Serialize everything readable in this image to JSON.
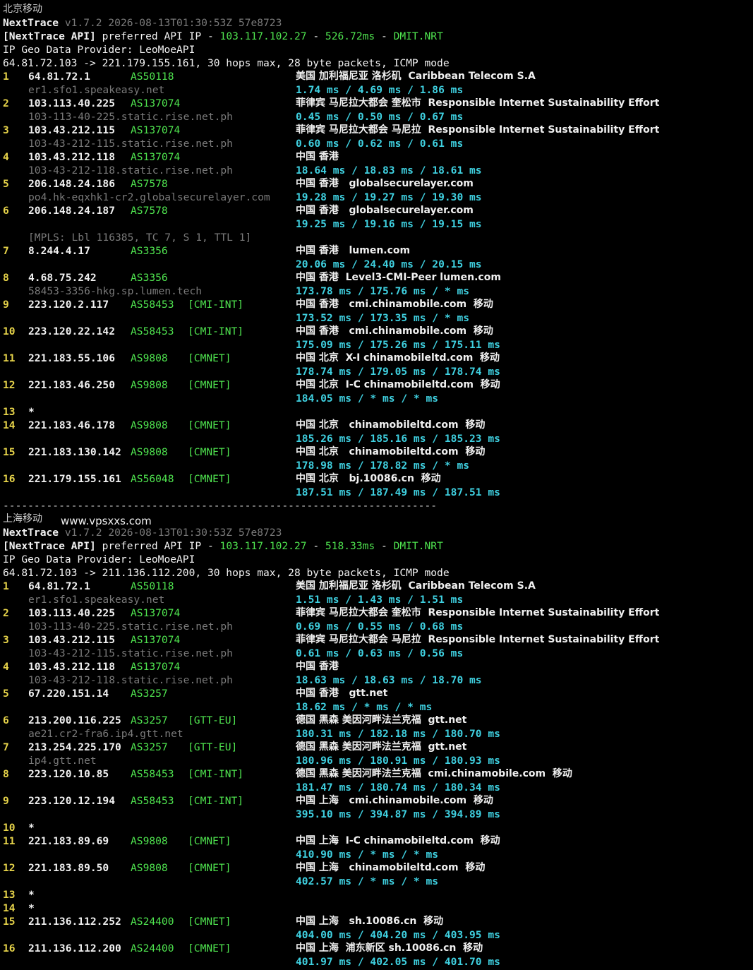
{
  "block1": {
    "title": "北京移动",
    "version_line": {
      "name": "NextTrace",
      "rest": " v1.7.2 2026-08-13T01:30:53Z 57e8723"
    },
    "api_line": {
      "prefix": "[NextTrace API]",
      "mid": " preferred API IP - ",
      "ip": "103.117.102.27",
      "sep": " - ",
      "ms": "526.72ms",
      "sep2": " - ",
      "node": "DMIT.NRT"
    },
    "geo_provider": "IP Geo Data Provider: LeoMoeAPI",
    "target_line": "64.81.72.103 -> 221.179.155.161, 30 hops max, 28 byte packets, ICMP mode",
    "hops": [
      {
        "n": "1",
        "ip": "64.81.72.1",
        "as": "AS50118",
        "tag": "",
        "geo": "美国 加利福尼亚 洛杉矶  Caribbean Telecom S.A",
        "host": "er1.sfo1.speakeasy.net",
        "rtt": "1.74 ms / 4.69 ms / 1.86 ms"
      },
      {
        "n": "2",
        "ip": "103.113.40.225",
        "as": "AS137074",
        "tag": "",
        "geo": "菲律宾 马尼拉大都会 奎松市  Responsible Internet Sustainability Effort",
        "host": "103-113-40-225.static.rise.net.ph",
        "rtt": "0.45 ms / 0.50 ms / 0.67 ms"
      },
      {
        "n": "3",
        "ip": "103.43.212.115",
        "as": "AS137074",
        "tag": "",
        "geo": "菲律宾 马尼拉大都会 马尼拉  Responsible Internet Sustainability Effort",
        "host": "103-43-212-115.static.rise.net.ph",
        "rtt": "0.60 ms / 0.62 ms / 0.61 ms"
      },
      {
        "n": "4",
        "ip": "103.43.212.118",
        "as": "AS137074",
        "tag": "",
        "geo": "中国 香港",
        "host": "103-43-212-118.static.rise.net.ph",
        "rtt": "18.64 ms / 18.83 ms / 18.61 ms"
      },
      {
        "n": "5",
        "ip": "206.148.24.186",
        "as": "AS7578",
        "tag": "",
        "geo": "中国 香港   globalsecurelayer.com",
        "host": "po4.hk-eqxhk1-cr2.globalsecurelayer.com",
        "rtt": "19.28 ms / 19.27 ms / 19.30 ms"
      },
      {
        "n": "6",
        "ip": "206.148.24.187",
        "as": "AS7578",
        "tag": "",
        "geo": "中国 香港   globalsecurelayer.com",
        "host": "",
        "rtt": "19.25 ms / 19.16 ms / 19.15 ms"
      },
      {
        "n": "",
        "ip": "",
        "as": "",
        "tag": "",
        "geo": "",
        "host": "[MPLS: Lbl 116385, TC 7, S 1, TTL 1]",
        "rtt": ""
      },
      {
        "n": "7",
        "ip": "8.244.4.17",
        "as": "AS3356",
        "tag": "",
        "geo": "中国 香港   lumen.com",
        "host": "",
        "rtt": "20.06 ms / 24.40 ms / 20.15 ms"
      },
      {
        "n": "8",
        "ip": "4.68.75.242",
        "as": "AS3356",
        "tag": "",
        "geo": "中国 香港  Level3-CMI-Peer lumen.com",
        "host": "58453-3356-hkg.sp.lumen.tech",
        "rtt": "173.78 ms / 175.76 ms / * ms"
      },
      {
        "n": "9",
        "ip": "223.120.2.117",
        "as": "AS58453",
        "tag": "[CMI-INT]",
        "geo": "中国 香港   cmi.chinamobile.com  移动",
        "host": "",
        "rtt": "173.52 ms / 173.35 ms / * ms"
      },
      {
        "n": "10",
        "ip": "223.120.22.142",
        "as": "AS58453",
        "tag": "[CMI-INT]",
        "geo": "中国 香港   cmi.chinamobile.com  移动",
        "host": "",
        "rtt": "175.09 ms / 175.26 ms / 175.11 ms"
      },
      {
        "n": "11",
        "ip": "221.183.55.106",
        "as": "AS9808",
        "tag": "[CMNET]",
        "geo": "中国 北京  X-I chinamobileltd.com  移动",
        "host": "",
        "rtt": "178.74 ms / 179.05 ms / 178.74 ms"
      },
      {
        "n": "12",
        "ip": "221.183.46.250",
        "as": "AS9808",
        "tag": "[CMNET]",
        "geo": "中国 北京  I-C chinamobileltd.com  移动",
        "host": "",
        "rtt": "184.05 ms / * ms / * ms"
      },
      {
        "n": "13",
        "ip": "*",
        "as": "",
        "tag": "",
        "geo": "",
        "host": "",
        "rtt": ""
      },
      {
        "n": "14",
        "ip": "221.183.46.178",
        "as": "AS9808",
        "tag": "[CMNET]",
        "geo": "中国 北京   chinamobileltd.com  移动",
        "host": "",
        "rtt": "185.26 ms / 185.16 ms / 185.23 ms"
      },
      {
        "n": "15",
        "ip": "221.183.130.142",
        "as": "AS9808",
        "tag": "[CMNET]",
        "geo": "中国 北京   chinamobileltd.com  移动",
        "host": "",
        "rtt": "178.98 ms / 178.82 ms / * ms"
      },
      {
        "n": "16",
        "ip": "221.179.155.161",
        "as": "AS56048",
        "tag": "[CMNET]",
        "geo": "中国 北京   bj.10086.cn  移动",
        "host": "",
        "rtt": "187.51 ms / 187.49 ms / 187.51 ms"
      }
    ]
  },
  "separator": "----------------------------------------------------------------------",
  "block2": {
    "title": "上海移动",
    "watermark": "www.vpsxxs.com",
    "version_line": {
      "name": "NextTrace",
      "rest": " v1.7.2 2026-08-13T01:30:53Z 57e8723"
    },
    "api_line": {
      "prefix": "[NextTrace API]",
      "mid": " preferred API IP - ",
      "ip": "103.117.102.27",
      "sep": " - ",
      "ms": "518.33ms",
      "sep2": " - ",
      "node": "DMIT.NRT"
    },
    "geo_provider": "IP Geo Data Provider: LeoMoeAPI",
    "target_line": "64.81.72.103 -> 211.136.112.200, 30 hops max, 28 byte packets, ICMP mode",
    "hops": [
      {
        "n": "1",
        "ip": "64.81.72.1",
        "as": "AS50118",
        "tag": "",
        "geo": "美国 加利福尼亚 洛杉矶  Caribbean Telecom S.A",
        "host": "er1.sfo1.speakeasy.net",
        "rtt": "1.51 ms / 1.43 ms / 1.51 ms"
      },
      {
        "n": "2",
        "ip": "103.113.40.225",
        "as": "AS137074",
        "tag": "",
        "geo": "菲律宾 马尼拉大都会 奎松市  Responsible Internet Sustainability Effort",
        "host": "103-113-40-225.static.rise.net.ph",
        "rtt": "0.69 ms / 0.55 ms / 0.68 ms"
      },
      {
        "n": "3",
        "ip": "103.43.212.115",
        "as": "AS137074",
        "tag": "",
        "geo": "菲律宾 马尼拉大都会 马尼拉  Responsible Internet Sustainability Effort",
        "host": "103-43-212-115.static.rise.net.ph",
        "rtt": "0.61 ms / 0.63 ms / 0.56 ms"
      },
      {
        "n": "4",
        "ip": "103.43.212.118",
        "as": "AS137074",
        "tag": "",
        "geo": "中国 香港",
        "host": "103-43-212-118.static.rise.net.ph",
        "rtt": "18.63 ms / 18.63 ms / 18.70 ms"
      },
      {
        "n": "5",
        "ip": "67.220.151.14",
        "as": "AS3257",
        "tag": "",
        "geo": "中国 香港   gtt.net",
        "host": "",
        "rtt": "18.62 ms / * ms / * ms"
      },
      {
        "n": "6",
        "ip": "213.200.116.225",
        "as": "AS3257",
        "tag": "[GTT-EU]",
        "geo": "德国 黑森 美因河畔法兰克福  gtt.net",
        "host": "ae21.cr2-fra6.ip4.gtt.net",
        "rtt": "180.31 ms / 182.18 ms / 180.70 ms"
      },
      {
        "n": "7",
        "ip": "213.254.225.170",
        "as": "AS3257",
        "tag": "[GTT-EU]",
        "geo": "德国 黑森 美因河畔法兰克福  gtt.net",
        "host": "ip4.gtt.net",
        "rtt": "180.96 ms / 180.91 ms / 180.93 ms"
      },
      {
        "n": "8",
        "ip": "223.120.10.85",
        "as": "AS58453",
        "tag": "[CMI-INT]",
        "geo": "德国 黑森 美因河畔法兰克福  cmi.chinamobile.com  移动",
        "host": "",
        "rtt": "181.47 ms / 180.74 ms / 180.34 ms"
      },
      {
        "n": "9",
        "ip": "223.120.12.194",
        "as": "AS58453",
        "tag": "[CMI-INT]",
        "geo": "中国 上海   cmi.chinamobile.com  移动",
        "host": "",
        "rtt": "395.10 ms / 394.87 ms / 394.89 ms"
      },
      {
        "n": "10",
        "ip": "*",
        "as": "",
        "tag": "",
        "geo": "",
        "host": "",
        "rtt": ""
      },
      {
        "n": "11",
        "ip": "221.183.89.69",
        "as": "AS9808",
        "tag": "[CMNET]",
        "geo": "中国 上海  I-C chinamobileltd.com  移动",
        "host": "",
        "rtt": "410.90 ms / * ms / * ms"
      },
      {
        "n": "12",
        "ip": "221.183.89.50",
        "as": "AS9808",
        "tag": "[CMNET]",
        "geo": "中国 上海   chinamobileltd.com  移动",
        "host": "",
        "rtt": "402.57 ms / * ms / * ms"
      },
      {
        "n": "13",
        "ip": "*",
        "as": "",
        "tag": "",
        "geo": "",
        "host": "",
        "rtt": ""
      },
      {
        "n": "14",
        "ip": "*",
        "as": "",
        "tag": "",
        "geo": "",
        "host": "",
        "rtt": ""
      },
      {
        "n": "15",
        "ip": "211.136.112.252",
        "as": "AS24400",
        "tag": "[CMNET]",
        "geo": "中国 上海   sh.10086.cn  移动",
        "host": "",
        "rtt": "404.00 ms / 404.20 ms / 403.95 ms"
      },
      {
        "n": "16",
        "ip": "211.136.112.200",
        "as": "AS24400",
        "tag": "[CMNET]",
        "geo": "中国 上海  浦东新区 sh.10086.cn  移动",
        "host": "",
        "rtt": "401.97 ms / 402.05 ms / 401.70 ms"
      }
    ]
  }
}
